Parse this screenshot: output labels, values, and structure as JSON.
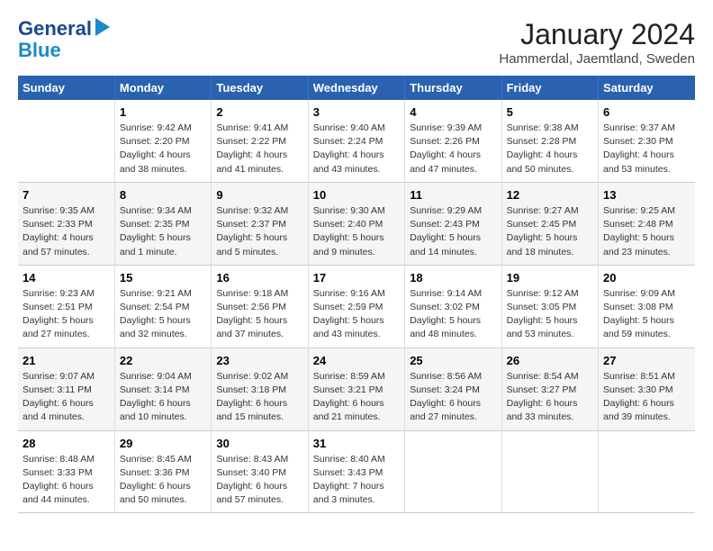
{
  "header": {
    "logo": {
      "line1": "General",
      "line2": "Blue"
    },
    "title": "January 2024",
    "location": "Hammerdal, Jaemtland, Sweden"
  },
  "calendar": {
    "days_of_week": [
      "Sunday",
      "Monday",
      "Tuesday",
      "Wednesday",
      "Thursday",
      "Friday",
      "Saturday"
    ],
    "weeks": [
      [
        {
          "day": null
        },
        {
          "day": "1",
          "sunrise": "9:42 AM",
          "sunset": "2:20 PM",
          "daylight": "4 hours and 38 minutes."
        },
        {
          "day": "2",
          "sunrise": "9:41 AM",
          "sunset": "2:22 PM",
          "daylight": "4 hours and 41 minutes."
        },
        {
          "day": "3",
          "sunrise": "9:40 AM",
          "sunset": "2:24 PM",
          "daylight": "4 hours and 43 minutes."
        },
        {
          "day": "4",
          "sunrise": "9:39 AM",
          "sunset": "2:26 PM",
          "daylight": "4 hours and 47 minutes."
        },
        {
          "day": "5",
          "sunrise": "9:38 AM",
          "sunset": "2:28 PM",
          "daylight": "4 hours and 50 minutes."
        },
        {
          "day": "6",
          "sunrise": "9:37 AM",
          "sunset": "2:30 PM",
          "daylight": "4 hours and 53 minutes."
        }
      ],
      [
        {
          "day": "7",
          "sunrise": "9:35 AM",
          "sunset": "2:33 PM",
          "daylight": "4 hours and 57 minutes."
        },
        {
          "day": "8",
          "sunrise": "9:34 AM",
          "sunset": "2:35 PM",
          "daylight": "5 hours and 1 minute."
        },
        {
          "day": "9",
          "sunrise": "9:32 AM",
          "sunset": "2:37 PM",
          "daylight": "5 hours and 5 minutes."
        },
        {
          "day": "10",
          "sunrise": "9:30 AM",
          "sunset": "2:40 PM",
          "daylight": "5 hours and 9 minutes."
        },
        {
          "day": "11",
          "sunrise": "9:29 AM",
          "sunset": "2:43 PM",
          "daylight": "5 hours and 14 minutes."
        },
        {
          "day": "12",
          "sunrise": "9:27 AM",
          "sunset": "2:45 PM",
          "daylight": "5 hours and 18 minutes."
        },
        {
          "day": "13",
          "sunrise": "9:25 AM",
          "sunset": "2:48 PM",
          "daylight": "5 hours and 23 minutes."
        }
      ],
      [
        {
          "day": "14",
          "sunrise": "9:23 AM",
          "sunset": "2:51 PM",
          "daylight": "5 hours and 27 minutes."
        },
        {
          "day": "15",
          "sunrise": "9:21 AM",
          "sunset": "2:54 PM",
          "daylight": "5 hours and 32 minutes."
        },
        {
          "day": "16",
          "sunrise": "9:18 AM",
          "sunset": "2:56 PM",
          "daylight": "5 hours and 37 minutes."
        },
        {
          "day": "17",
          "sunrise": "9:16 AM",
          "sunset": "2:59 PM",
          "daylight": "5 hours and 43 minutes."
        },
        {
          "day": "18",
          "sunrise": "9:14 AM",
          "sunset": "3:02 PM",
          "daylight": "5 hours and 48 minutes."
        },
        {
          "day": "19",
          "sunrise": "9:12 AM",
          "sunset": "3:05 PM",
          "daylight": "5 hours and 53 minutes."
        },
        {
          "day": "20",
          "sunrise": "9:09 AM",
          "sunset": "3:08 PM",
          "daylight": "5 hours and 59 minutes."
        }
      ],
      [
        {
          "day": "21",
          "sunrise": "9:07 AM",
          "sunset": "3:11 PM",
          "daylight": "6 hours and 4 minutes."
        },
        {
          "day": "22",
          "sunrise": "9:04 AM",
          "sunset": "3:14 PM",
          "daylight": "6 hours and 10 minutes."
        },
        {
          "day": "23",
          "sunrise": "9:02 AM",
          "sunset": "3:18 PM",
          "daylight": "6 hours and 15 minutes."
        },
        {
          "day": "24",
          "sunrise": "8:59 AM",
          "sunset": "3:21 PM",
          "daylight": "6 hours and 21 minutes."
        },
        {
          "day": "25",
          "sunrise": "8:56 AM",
          "sunset": "3:24 PM",
          "daylight": "6 hours and 27 minutes."
        },
        {
          "day": "26",
          "sunrise": "8:54 AM",
          "sunset": "3:27 PM",
          "daylight": "6 hours and 33 minutes."
        },
        {
          "day": "27",
          "sunrise": "8:51 AM",
          "sunset": "3:30 PM",
          "daylight": "6 hours and 39 minutes."
        }
      ],
      [
        {
          "day": "28",
          "sunrise": "8:48 AM",
          "sunset": "3:33 PM",
          "daylight": "6 hours and 44 minutes."
        },
        {
          "day": "29",
          "sunrise": "8:45 AM",
          "sunset": "3:36 PM",
          "daylight": "6 hours and 50 minutes."
        },
        {
          "day": "30",
          "sunrise": "8:43 AM",
          "sunset": "3:40 PM",
          "daylight": "6 hours and 57 minutes."
        },
        {
          "day": "31",
          "sunrise": "8:40 AM",
          "sunset": "3:43 PM",
          "daylight": "7 hours and 3 minutes."
        },
        {
          "day": null
        },
        {
          "day": null
        },
        {
          "day": null
        }
      ]
    ]
  }
}
